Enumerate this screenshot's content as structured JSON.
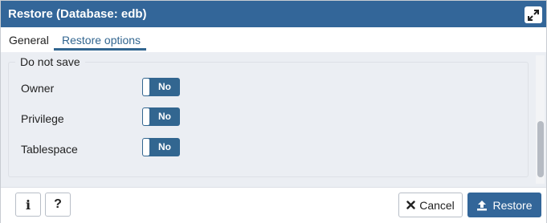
{
  "dialog": {
    "title": "Restore (Database: edb)",
    "maximize_icon": "expand-icon"
  },
  "tabs": [
    {
      "label": "General",
      "active": false
    },
    {
      "label": "Restore options",
      "active": true
    }
  ],
  "section": {
    "legend": "Do not save",
    "rows": [
      {
        "label": "Owner",
        "toggle": "No"
      },
      {
        "label": "Privilege",
        "toggle": "No"
      },
      {
        "label": "Tablespace",
        "toggle": "No"
      }
    ]
  },
  "footer": {
    "info_icon": "info-icon",
    "help_icon": "question-icon",
    "cancel_label": "Cancel",
    "restore_label": "Restore"
  },
  "colors": {
    "header": "#336699",
    "accent": "#326690",
    "content_bg": "#ebeef3"
  }
}
